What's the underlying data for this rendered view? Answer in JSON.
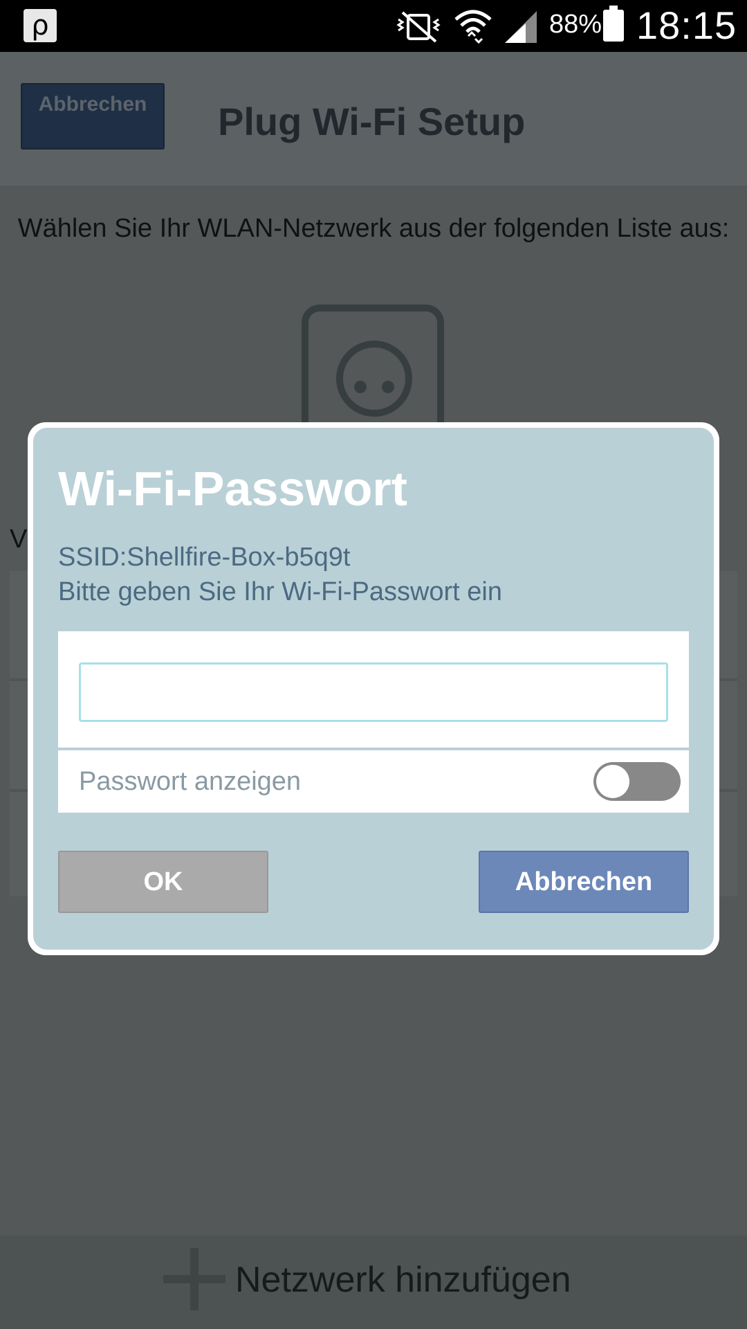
{
  "status_bar": {
    "app_icon_glyph": "ρ",
    "icons": [
      "vibrate-off-icon",
      "wifi-icon",
      "signal-icon",
      "battery-icon"
    ],
    "battery": "88%",
    "time": "18:15"
  },
  "app": {
    "cancel_button": "Abbrechen",
    "title": "Plug Wi-Fi Setup",
    "instruction": "Wählen Sie Ihr WLAN-Netzwerk aus der folgenden Liste aus:",
    "partial_label": "V",
    "add_network": "Netzwerk hinzufügen"
  },
  "dialog": {
    "title": "Wi-Fi-Passwort",
    "ssid": "SSID:Shellfire-Box-b5q9t",
    "message": "Bitte geben Sie Ihr Wi-Fi-Passwort ein",
    "password_value": "",
    "show_password_label": "Passwort anzeigen",
    "show_password_on": false,
    "ok_button": "OK",
    "cancel_button": "Abbrechen"
  }
}
